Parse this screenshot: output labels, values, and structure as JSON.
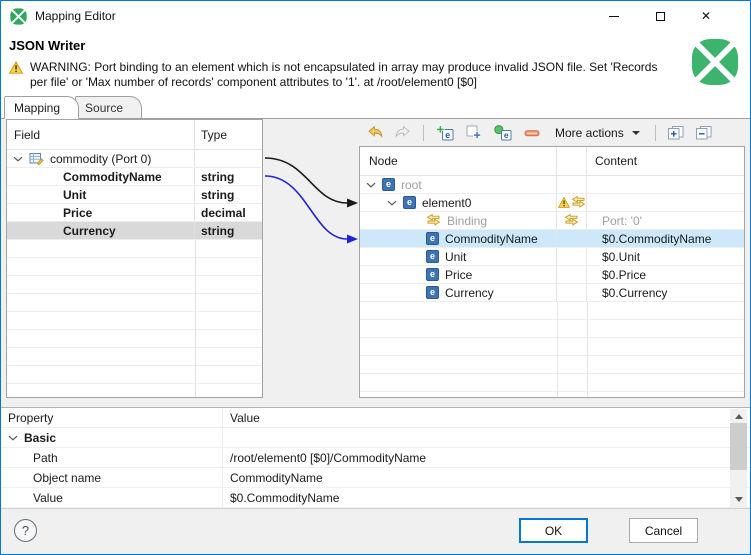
{
  "window": {
    "title": "Mapping Editor"
  },
  "header": {
    "title": "JSON Writer",
    "warning": "WARNING: Port binding to an element which is not encapsulated in array may produce invalid JSON file. Set 'Records per file' or 'Max number of records' component attributes to '1'. at /root/element0 [$0]"
  },
  "tabs": [
    {
      "label": "Mapping",
      "active": true
    },
    {
      "label": "Source",
      "active": false
    }
  ],
  "field_table": {
    "columns": [
      "Field",
      "Type"
    ],
    "root_label": "commodity (Port 0)",
    "rows": [
      {
        "field": "CommodityName",
        "type": "string",
        "selected": false
      },
      {
        "field": "Unit",
        "type": "string",
        "selected": false
      },
      {
        "field": "Price",
        "type": "decimal",
        "selected": false
      },
      {
        "field": "Currency",
        "type": "string",
        "selected": true
      }
    ]
  },
  "toolbar": {
    "more_actions_label": "More actions",
    "icons": [
      "undo",
      "redo",
      "add-element",
      "add-attribute",
      "add-wildcard-element",
      "remove",
      "expand-all",
      "collapse-all"
    ]
  },
  "node_table": {
    "columns": [
      "Node",
      "Content"
    ],
    "rows": [
      {
        "label": "root",
        "content": "",
        "muted": true
      },
      {
        "label": "element0",
        "content": "",
        "muted": false,
        "warning": true,
        "binding": true
      },
      {
        "label": "Binding",
        "content": "Port: '0'",
        "muted": true,
        "binding": true
      },
      {
        "label": "CommodityName",
        "content": "$0.CommodityName",
        "muted": false,
        "selected": true
      },
      {
        "label": "Unit",
        "content": "$0.Unit",
        "muted": false
      },
      {
        "label": "Price",
        "content": "$0.Price",
        "muted": false
      },
      {
        "label": "Currency",
        "content": "$0.Currency",
        "muted": false
      }
    ]
  },
  "properties": {
    "columns": [
      "Property",
      "Value"
    ],
    "group_label": "Basic",
    "rows": [
      {
        "property": "Path",
        "value": "/root/element0 [$0]/CommodityName"
      },
      {
        "property": "Object name",
        "value": "CommodityName"
      },
      {
        "property": "Value",
        "value": "$0.CommodityName"
      }
    ]
  },
  "footer": {
    "ok": "OK",
    "cancel": "Cancel"
  },
  "icons": {
    "close": "✕",
    "help": "?",
    "element_glyph": "e"
  },
  "colors": {
    "window_border": "#0078d7",
    "clover_green": "#3cb46e",
    "selection_blue": "#cde8fa",
    "selection_gray": "#d9d9d9",
    "warning_amber": "#ffd34d",
    "binding_gold": "#c9971c",
    "arrow_black": "#1a1a1a",
    "arrow_blue": "#2121dd"
  }
}
